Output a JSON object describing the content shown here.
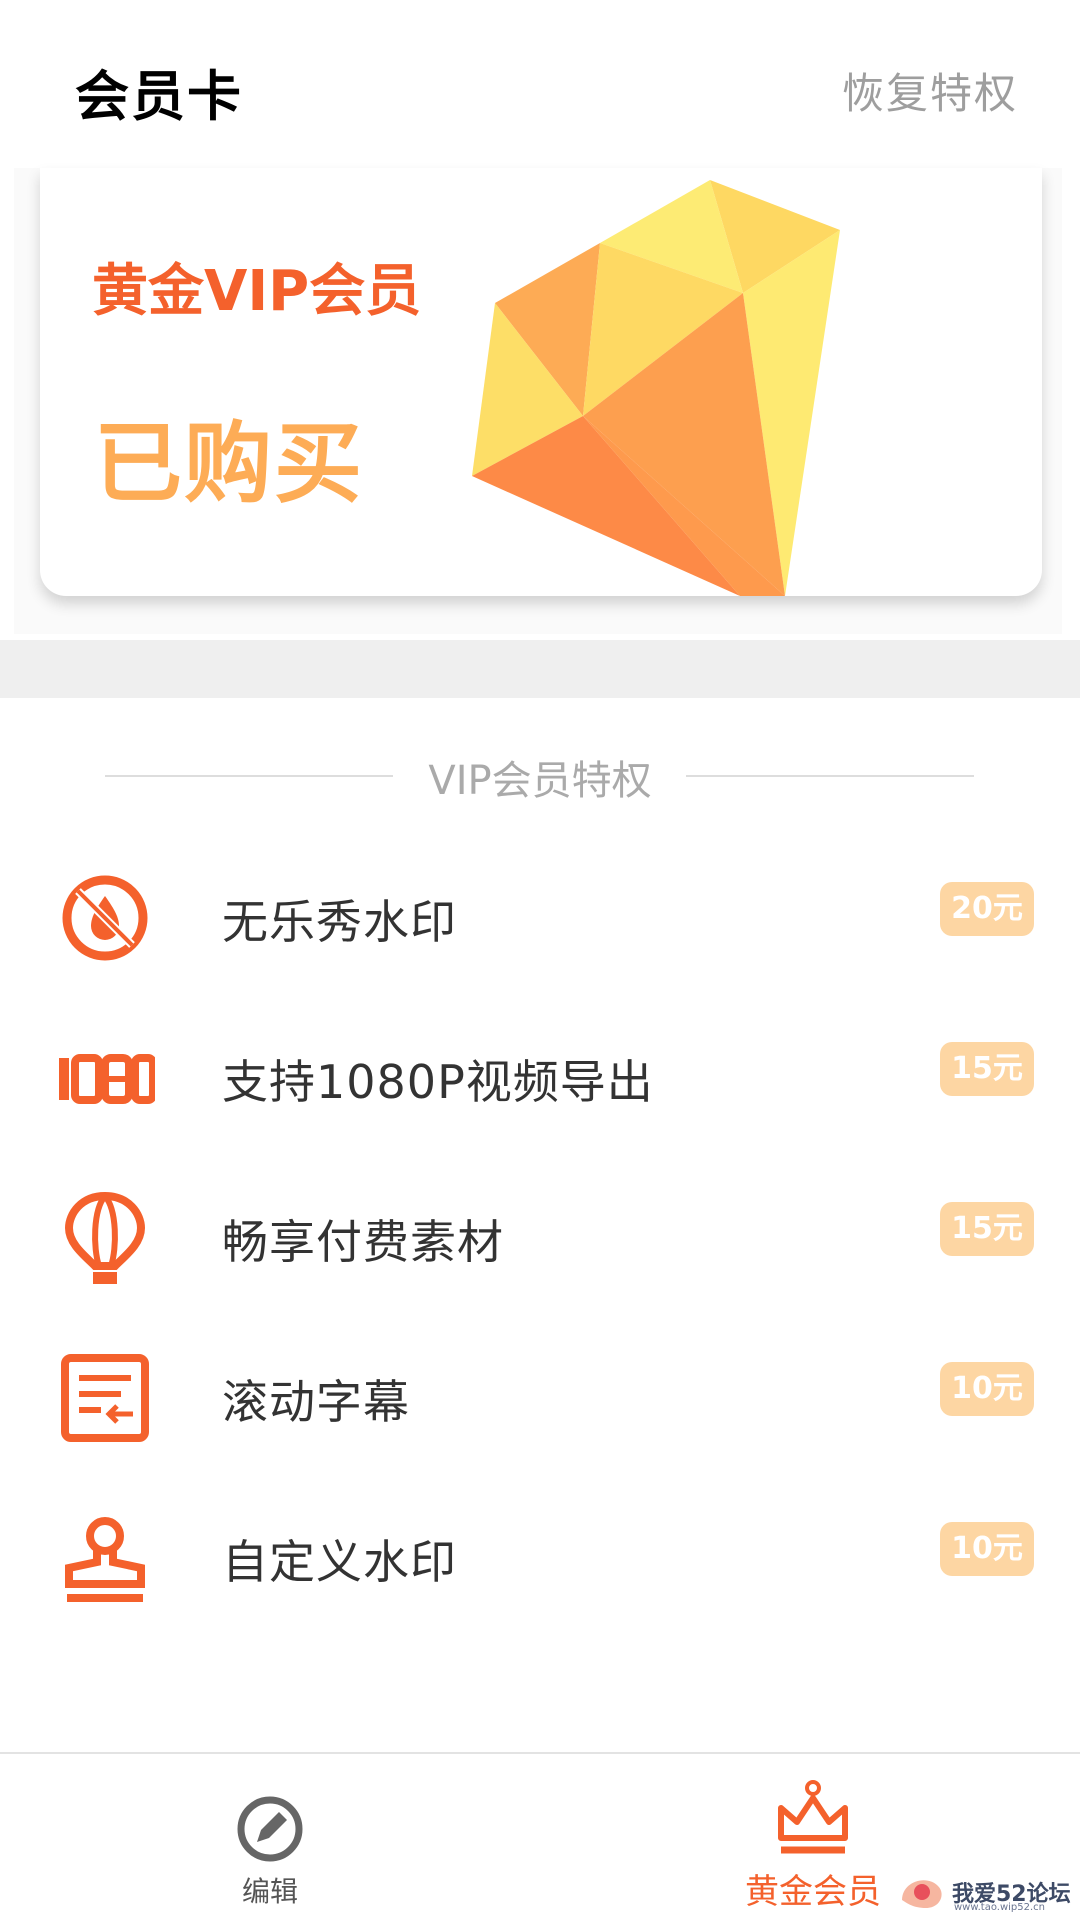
{
  "header": {
    "title": "会员卡",
    "restore_label": "恢复特权"
  },
  "card": {
    "title": "黄金VIP会员",
    "status": "已购买"
  },
  "privileges": {
    "section_title": "VIP会员特权",
    "items": [
      {
        "label": "无乐秀水印",
        "price": "20元",
        "icon": "no-watermark-icon"
      },
      {
        "label": "支持1080P视频导出",
        "price": "15元",
        "icon": "hd-1080-icon"
      },
      {
        "label": "畅享付费素材",
        "price": "15元",
        "icon": "balloon-icon"
      },
      {
        "label": "滚动字幕",
        "price": "10元",
        "icon": "scrolling-subtitle-icon"
      },
      {
        "label": "自定义水印",
        "price": "10元",
        "icon": "stamp-icon"
      }
    ]
  },
  "tabbar": {
    "tabs": [
      {
        "label": "编辑",
        "icon": "pencil-icon",
        "active": false
      },
      {
        "label": "黄金会员",
        "icon": "crown-icon",
        "active": true
      }
    ]
  },
  "watermark": {
    "text": "我爱52论坛",
    "subtext": "www.tao.wip52.cn"
  },
  "colors": {
    "accent": "#f4612c",
    "status_orange": "#fdac56",
    "badge_bg": "#fdd6a3",
    "muted_text": "#9e9e9e"
  }
}
